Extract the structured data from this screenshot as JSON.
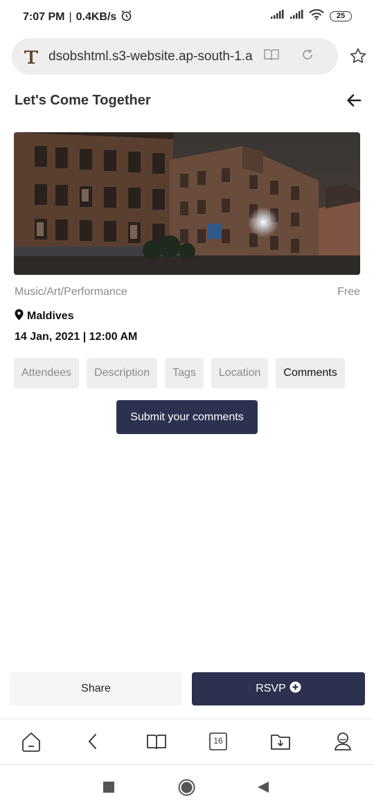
{
  "status_bar": {
    "time": "7:07 PM",
    "separator": "|",
    "speed": "0.4KB/s",
    "battery": "25"
  },
  "browser": {
    "url": "dsobshtml.s3-website.ap-south-1.a",
    "tab_count": "16"
  },
  "header": {
    "title": "Let's Come Together"
  },
  "event": {
    "category": "Music/Art/Performance",
    "price": "Free",
    "location": "Maldives",
    "datetime": "14 Jan, 2021 | 12:00 AM"
  },
  "tabs": [
    {
      "label": "Attendees"
    },
    {
      "label": "Description"
    },
    {
      "label": "Tags"
    },
    {
      "label": "Location"
    },
    {
      "label": "Comments"
    }
  ],
  "active_tab": "Comments",
  "comments": {
    "submit_label": "Submit your comments"
  },
  "actions": {
    "share_label": "Share",
    "rsvp_label": "RSVP"
  },
  "colors": {
    "primary": "#2d3150",
    "muted_text": "#8a8a8a",
    "tab_bg": "#eeeeee"
  }
}
